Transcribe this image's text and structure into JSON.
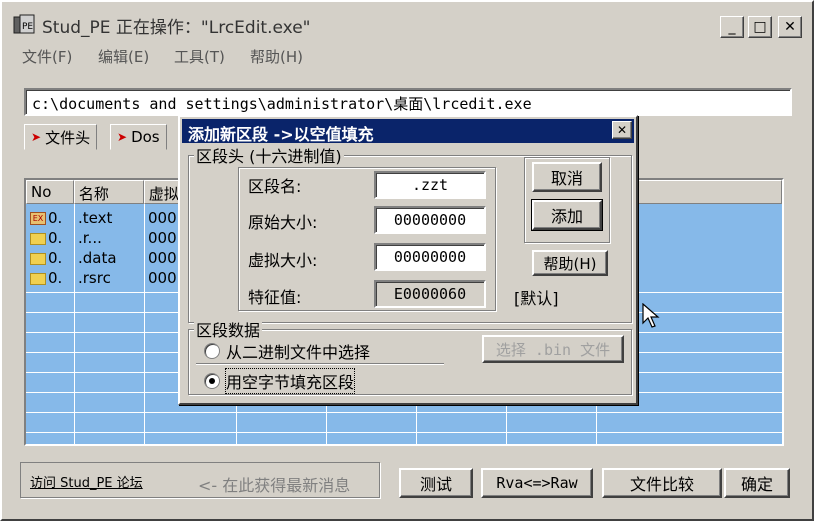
{
  "window": {
    "title": "Stud_PE 正在操作：\"LrcEdit.exe\"",
    "minimize_glyph": "_",
    "maximize_glyph": "□",
    "close_glyph": "✕"
  },
  "menu": [
    "文件(F)",
    "编辑(E)",
    "工具(T)",
    "帮助(H)"
  ],
  "path": "c:\\documents and settings\\administrator\\桌面\\lrcedit.exe",
  "tabs": [
    {
      "label": "文件头"
    },
    {
      "label": "Dos"
    }
  ],
  "table": {
    "columns": [
      "No",
      "名称",
      "虚拟"
    ],
    "rows": [
      {
        "no": "0.",
        "name": ".text",
        "v": "000",
        "icon": "exe"
      },
      {
        "no": "0.",
        "name": ".r...",
        "v": "000",
        "icon": "folder"
      },
      {
        "no": "0.",
        "name": ".data",
        "v": "000",
        "icon": "folder"
      },
      {
        "no": "0.",
        "name": ".rsrc",
        "v": "000",
        "icon": "folder"
      }
    ]
  },
  "footer": {
    "forum_link": "访问 Stud_PE 论坛",
    "news_hint": "<- 在此获得最新消息",
    "test": "测试",
    "rva_raw": "Rva<=>Raw",
    "compare": "文件比较",
    "ok": "确定"
  },
  "dialog": {
    "title": "添加新区段 ->以空值填充",
    "close_glyph": "✕",
    "header_group": "区段头 (十六进制值)",
    "name_label": "区段名:",
    "name_value": ".zzt",
    "raw_size_label": "原始大小:",
    "raw_size_value": "00000000",
    "virtual_size_label": "虚拟大小:",
    "virtual_size_value": "00000000",
    "characteristics_label": "特征值:",
    "characteristics_value": "E0000060",
    "default_label": "[默认]",
    "cancel": "取消",
    "add": "添加",
    "help": "帮助(H)",
    "data_group": "区段数据",
    "radio_binary": "从二进制文件中选择",
    "radio_fill": "用空字节填充区段",
    "select_bin": "选择 .bin 文件",
    "selected_option": "radio_fill"
  }
}
